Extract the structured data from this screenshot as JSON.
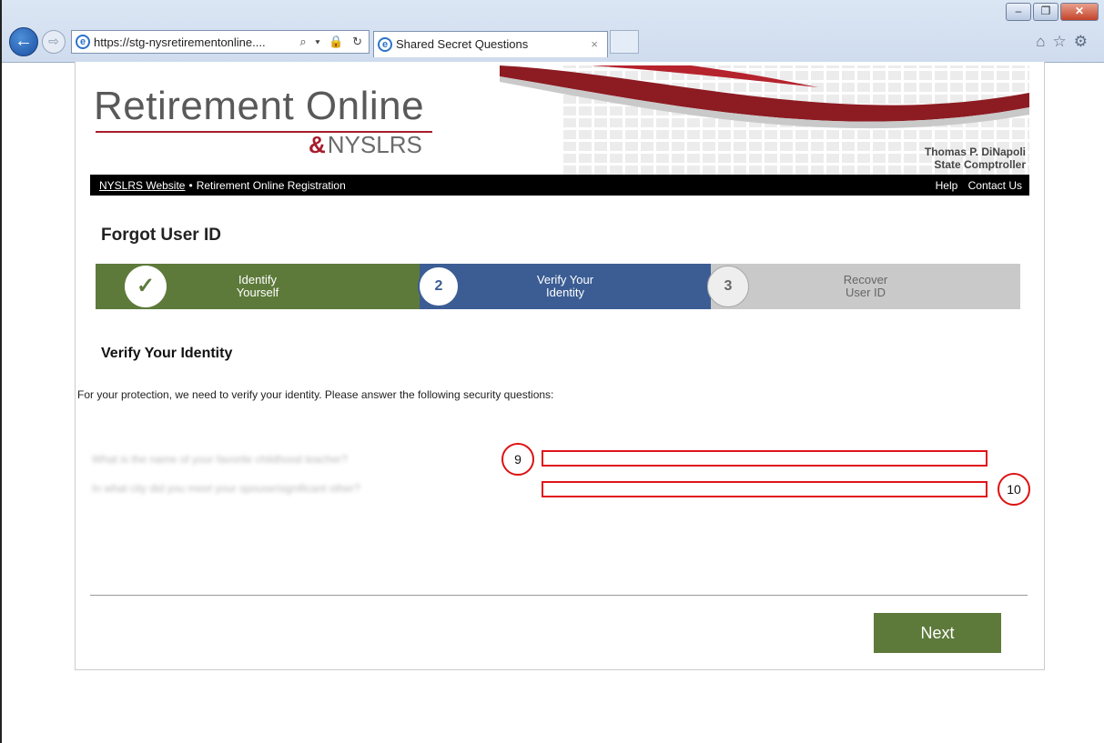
{
  "browser": {
    "address": "https://stg-nysretirementonline.... ",
    "address_tools": "⌕ ▾ 🔒 ↻",
    "tab_title": "Shared Secret Questions",
    "tab_close": "×",
    "window_min": "–",
    "window_max": "❐",
    "window_close": "✕",
    "right_icons": "⌂☆⚙"
  },
  "banner": {
    "logo_title": "Retirement Online",
    "logo_sub": "NYSLRS",
    "comptroller_name": "Thomas P. DiNapoli",
    "comptroller_title": "State Comptroller"
  },
  "nav": {
    "website_link": "NYSLRS Website",
    "separator": "•",
    "registration": "Retirement Online Registration",
    "help": "Help",
    "contact": "Contact Us"
  },
  "page_title": "Forgot User ID",
  "steps": [
    {
      "marker": "✓",
      "label_line1": "Identify",
      "label_line2": "Yourself",
      "status": "complete",
      "color": "#5d7a3a"
    },
    {
      "marker": "2",
      "label_line1": "Verify Your",
      "label_line2": "Identity",
      "status": "current",
      "color": "#3b5d94"
    },
    {
      "marker": "3",
      "label_line1": "Recover",
      "label_line2": "User ID",
      "status": "pending",
      "color": "#c9c9c9"
    }
  ],
  "section_title": "Verify Your Identity",
  "instructions": "For your protection, we need to verify your identity. Please answer the following security questions:",
  "questions": [
    {
      "text": "What is the name of your favorite childhood teacher?",
      "answer": "",
      "marker": "9"
    },
    {
      "text": "In what city did you meet your spouse/significant other?",
      "answer": "",
      "marker": "10"
    }
  ],
  "next_button": "Next"
}
